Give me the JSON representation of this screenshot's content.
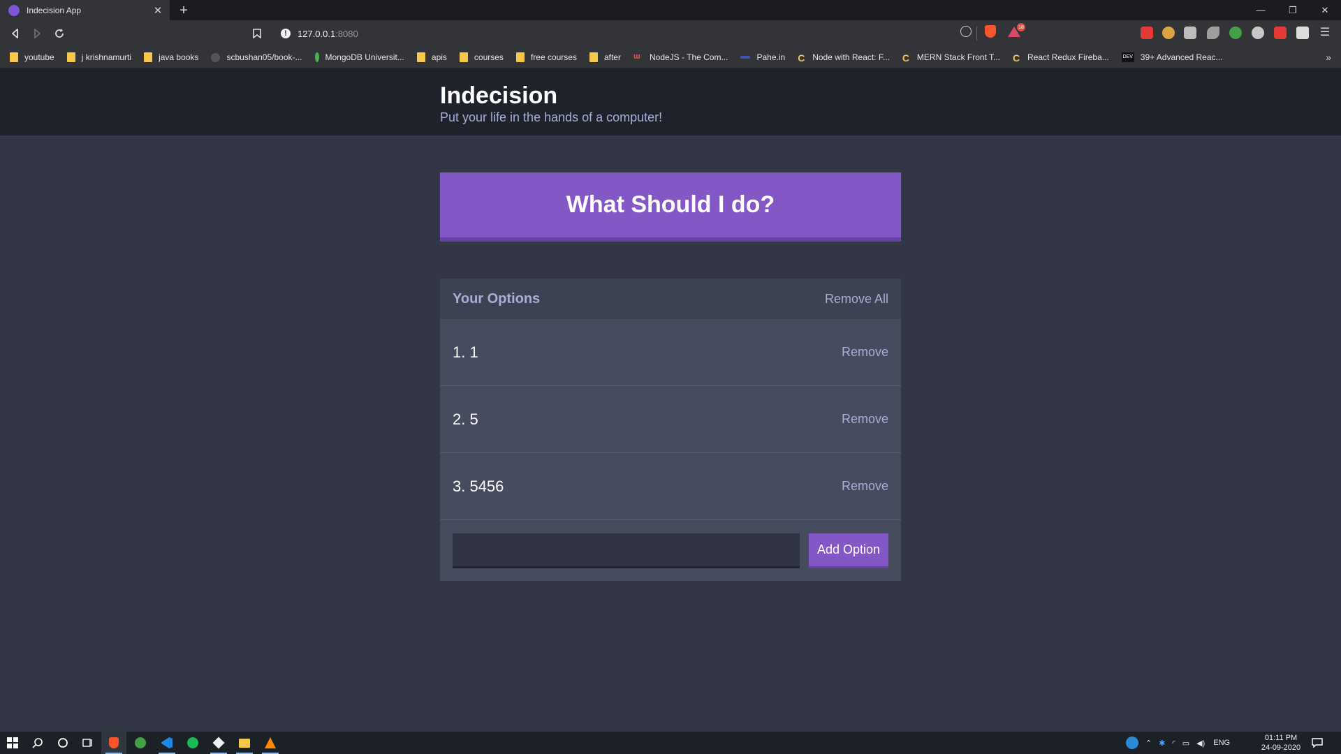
{
  "browser": {
    "tab_title": "Indecision App",
    "url_host": "127.0.0.1",
    "url_port": ":8080",
    "rewards_badge": "18",
    "bookmarks": [
      {
        "label": "youtube",
        "icon": "folder-icon"
      },
      {
        "label": "j krishnamurti",
        "icon": "folder-icon"
      },
      {
        "label": "java books",
        "icon": "folder-icon"
      },
      {
        "label": "scbushan05/book-...",
        "icon": "github-icon"
      },
      {
        "label": "MongoDB Universit...",
        "icon": "mongodb-leaf-icon"
      },
      {
        "label": "apis",
        "icon": "folder-icon"
      },
      {
        "label": "courses",
        "icon": "folder-icon"
      },
      {
        "label": "free courses",
        "icon": "folder-icon"
      },
      {
        "label": "after",
        "icon": "folder-icon"
      },
      {
        "label": "NodeJS - The Com...",
        "icon": "udemy-icon"
      },
      {
        "label": "Pahe.in",
        "icon": "pahe-icon"
      },
      {
        "label": "Node with React: F...",
        "icon": "c-icon"
      },
      {
        "label": "MERN Stack Front T...",
        "icon": "c-icon"
      },
      {
        "label": "React Redux Fireba...",
        "icon": "c-icon"
      },
      {
        "label": "39+ Advanced Reac...",
        "icon": "dev-icon"
      }
    ],
    "bookmarks_more": "»"
  },
  "app": {
    "title": "Indecision",
    "subtitle": "Put your life in the hands of a computer!",
    "action_button": "What Should I do?",
    "widget_title": "Your Options",
    "remove_all": "Remove All",
    "options": [
      {
        "text": "1. 1",
        "remove": "Remove"
      },
      {
        "text": "2. 5",
        "remove": "Remove"
      },
      {
        "text": "3. 5456",
        "remove": "Remove"
      }
    ],
    "input_value": "",
    "add_button": "Add Option"
  },
  "taskbar": {
    "language": "ENG",
    "time": "01:11 PM",
    "date": "24-09-2020"
  },
  "colors": {
    "accent": "#8357c5",
    "accent_dark": "#6a40a9",
    "page_bg": "#333645",
    "header_bg": "#20222b",
    "widget_bg": "#464b5e",
    "muted_text": "#a5afd7"
  }
}
